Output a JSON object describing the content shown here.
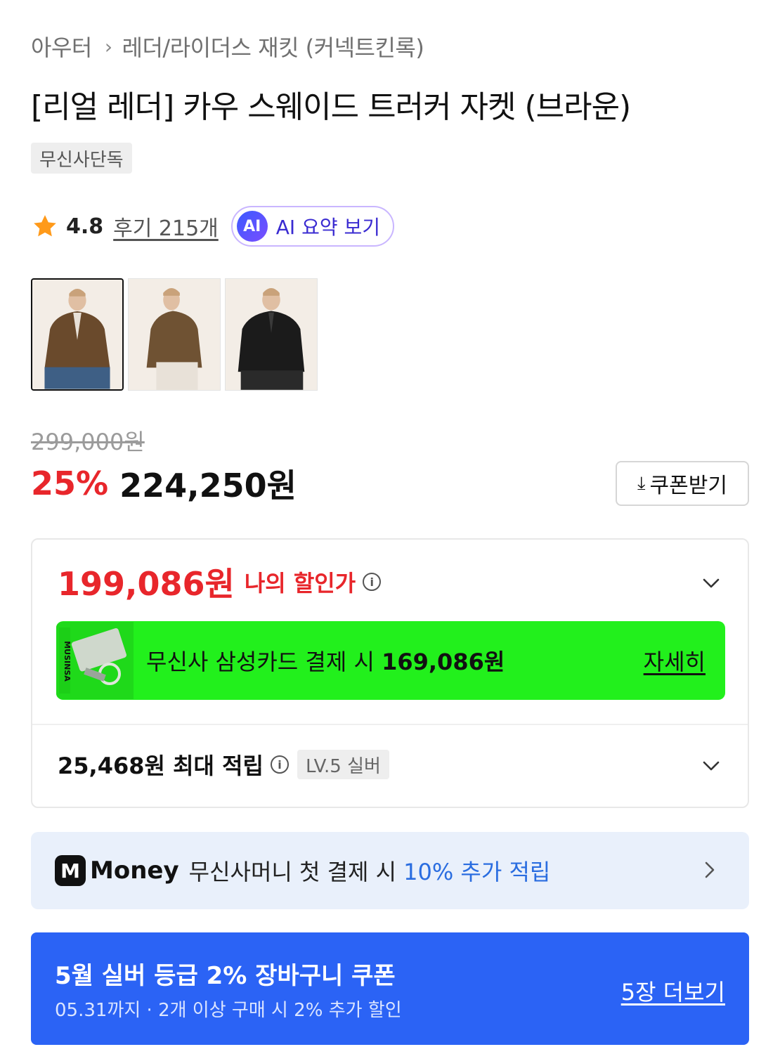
{
  "breadcrumb": {
    "level1": "아우터",
    "level2": "레더/라이더스 재킷 (커넥트킨록)"
  },
  "product": {
    "title": "[리얼 레더] 카우 스웨이드 트러커 자켓 (브라운)",
    "exclusive_badge": "무신사단독",
    "rating": "4.8",
    "reviews_label": "후기 215개",
    "ai_badge": "AI",
    "ai_summary_label": "AI 요약 보기"
  },
  "thumbnails": [
    {
      "alt": "brown jacket front",
      "color": "#6a4a2c"
    },
    {
      "alt": "brown jacket side",
      "color": "#6f5233"
    },
    {
      "alt": "black jacket front",
      "color": "#1b1b1b"
    }
  ],
  "price": {
    "original": "299,000원",
    "discount_rate": "25%",
    "sale": "224,250원",
    "coupon_button": "쿠폰받기"
  },
  "my_discount": {
    "price": "199,086원",
    "label": "나의 할인가",
    "card_banner_prefix": "무신사 삼성카드 결제 시",
    "card_banner_price": "169,086원",
    "card_banner_link": "자세히",
    "points_text": "25,468원 최대 적립",
    "level_badge": "LV.5 실버"
  },
  "money": {
    "icon": "M",
    "word": "Money",
    "text": "무신사머니 첫 결제 시",
    "highlight": "10% 추가 적립"
  },
  "coupon_banner": {
    "title": "5월 실버 등급 2% 장바구니 쿠폰",
    "subtitle": "05.31까지 · 2개 이상 구매 시 2% 추가 할인",
    "more": "5장 더보기"
  },
  "colors": {
    "red": "#e8262b",
    "card_green": "#22f01c",
    "money_bg": "#e9f0fb",
    "money_blue": "#2a6de0",
    "coupon_blue": "#2b63f5",
    "star": "#ff9a1a"
  },
  "icons": {
    "star": "star-icon",
    "info": "info-icon",
    "chevron": "chevron-down-icon",
    "download": "download-icon",
    "chevron_right": "chevron-right-icon"
  }
}
